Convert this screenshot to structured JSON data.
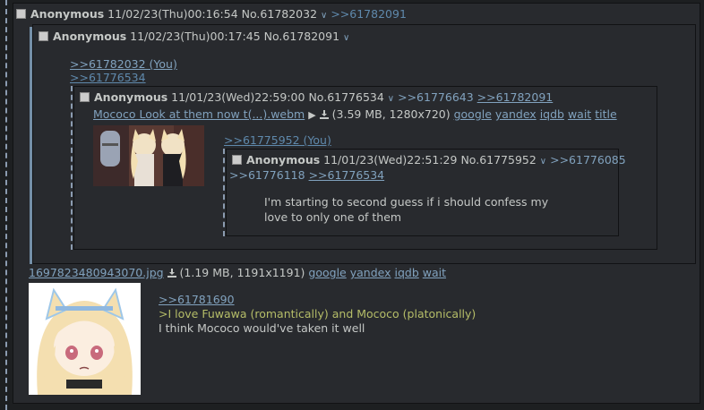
{
  "outer_post": {
    "name": "Anonymous",
    "datetime": "11/02/23(Thu)00:16:54",
    "post_no": "No.61782032",
    "backlink": ">>61782091",
    "file_name": "1697823480943070.jpg",
    "file_info": "(1.19 MB, 1191x1191)",
    "file_links": [
      "google",
      "yandex",
      "iqdb",
      "wait"
    ],
    "quote_link": ">>61781690",
    "greentext": ">I love Fuwawa (romantically) and Mococo (platonically)",
    "comment": "I think Mococo would've taken it well"
  },
  "reply_post": {
    "name": "Anonymous",
    "datetime": "11/02/23(Thu)00:17:45",
    "post_no": "No.61782091",
    "quote_you": ">>61782032 (You)",
    "quote_other": ">>61776534"
  },
  "inline_post": {
    "name": "Anonymous",
    "datetime": "11/01/23(Wed)22:59:00",
    "post_no": "No.61776534",
    "backlink_1": ">>61776643",
    "backlink_2": ">>61782091",
    "file_name": "Mococo Look at them now t(...).webm",
    "play_symbol": "▶",
    "file_info": "(3.59 MB, 1280x720)",
    "file_links": [
      "google",
      "yandex",
      "iqdb",
      "wait",
      "title"
    ],
    "quote_you": ">>61775952 (You)"
  },
  "nested_post": {
    "name": "Anonymous",
    "datetime": "11/01/23(Wed)22:51:29",
    "post_no": "No.61775952",
    "backlink_1": ">>61776085",
    "backlink_2": ">>61776118",
    "backlink_3": ">>61776534",
    "comment": "I'm starting to second guess if i should confess my love to only one of them"
  },
  "icons": {
    "checkbox": "checkbox-icon",
    "chevron": "chevron-down-icon",
    "download": "download-icon",
    "play": "play-icon"
  },
  "colors": {
    "background": "#1d1f21",
    "post_bg": "#282a2e",
    "text": "#c5c8c6",
    "link": "#81a2be",
    "greentext": "#b5bd68"
  }
}
